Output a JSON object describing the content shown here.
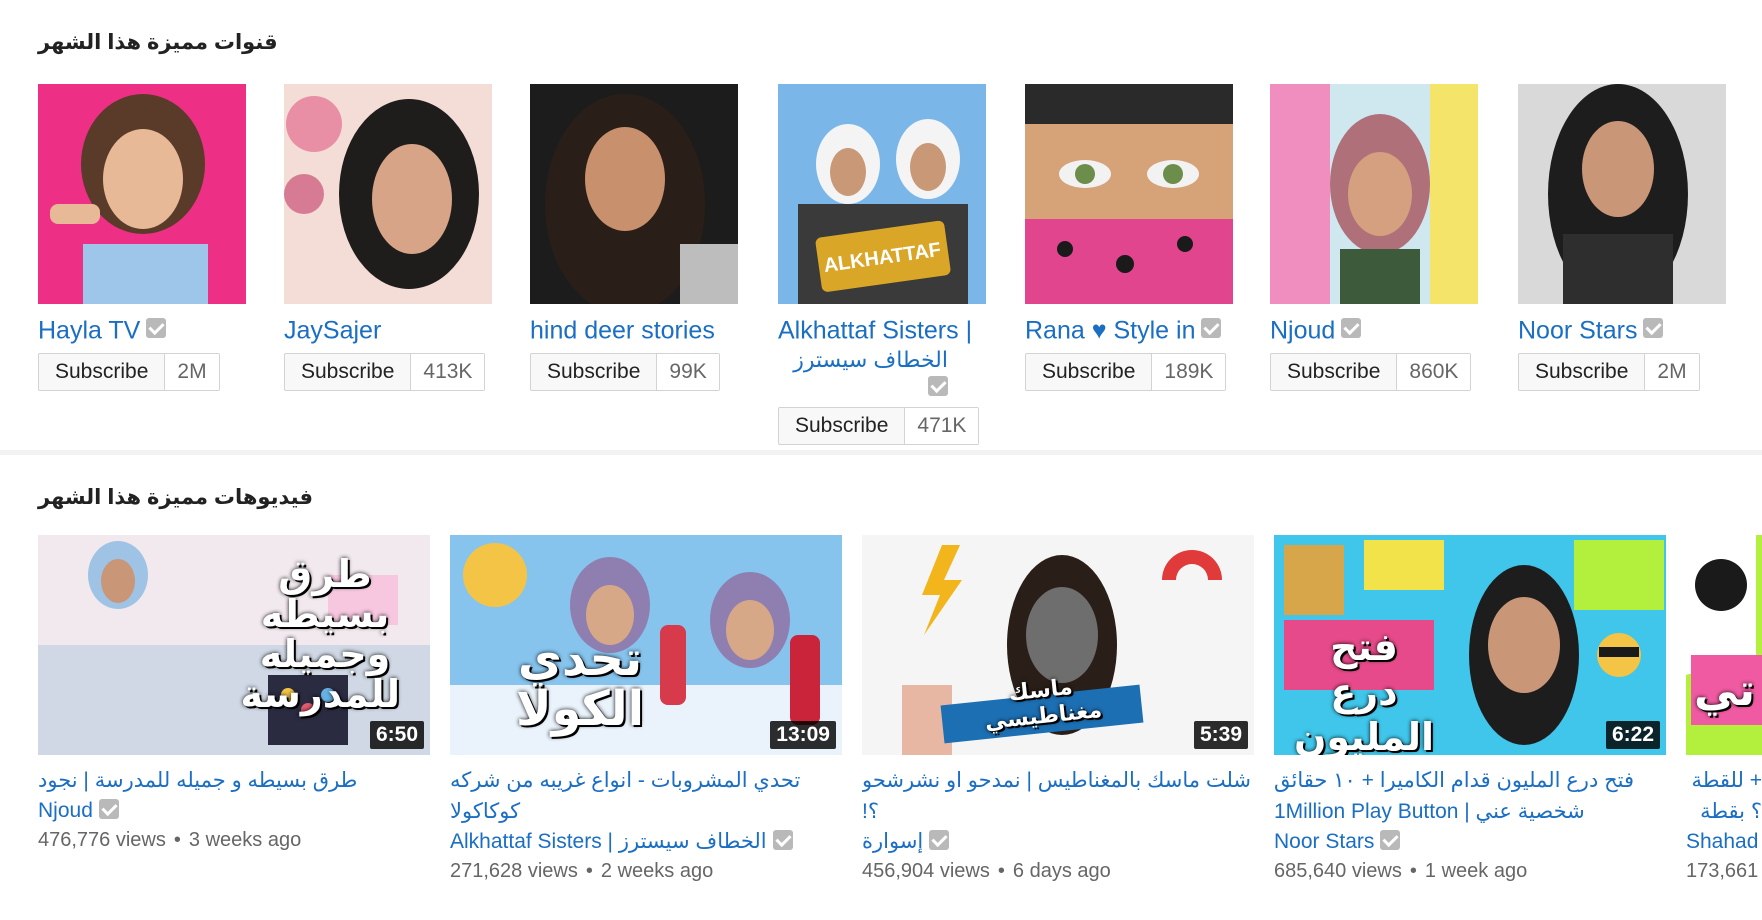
{
  "channels_shelf": {
    "title": "قنوات مميزة هذا الشهر",
    "channels": [
      {
        "name": "Hayla TV",
        "name2": "",
        "subscribe_label": "Subscribe",
        "count": "2M",
        "bg": "#ee2f86"
      },
      {
        "name": "JaySajer",
        "name2": "",
        "subscribe_label": "Subscribe",
        "count": "413K",
        "bg": "#f5e1de"
      },
      {
        "name": "hind deer stories",
        "name2": "",
        "subscribe_label": "Subscribe",
        "count": "99K",
        "bg": "#1f1f1f"
      },
      {
        "name": "Alkhattaf Sisters |",
        "name2": "الخطاف سيسترز",
        "subscribe_label": "Subscribe",
        "count": "471K",
        "bg": "#7ab6e8"
      },
      {
        "name": "Rana ♥ Style in",
        "name2": "",
        "subscribe_label": "Subscribe",
        "count": "189K",
        "bg": "#d6a277"
      },
      {
        "name": "Njoud",
        "name2": "",
        "subscribe_label": "Subscribe",
        "count": "860K",
        "bg": "#cfe8f0"
      },
      {
        "name": "Noor Stars",
        "name2": "",
        "subscribe_label": "Subscribe",
        "count": "2M",
        "bg": "#d9d9d9"
      }
    ]
  },
  "videos_shelf": {
    "title": "فيديوهات مميزة هذا الشهر",
    "videos": [
      {
        "title": "طرق بسيطه و جميله للمدرسة | نجود",
        "channel": "Njoud",
        "views": "476,776 views",
        "age": "3 weeks ago",
        "duration": "6:50",
        "overlay": "طرق بسيطه وجميله للمدرسة"
      },
      {
        "title": "تحدي المشروبات - انواع غريبه من شركه كوكاكولا",
        "channel": "Alkhattaf Sisters | الخطاف سيسترز",
        "views": "271,628 views",
        "age": "2 weeks ago",
        "duration": "13:09",
        "overlay": "تحدي الكولا"
      },
      {
        "title": "شلت ماسك بالمغناطيس | نمدحو او نشرشحو ؟!",
        "channel": "إسوارة",
        "views": "456,904 views",
        "age": "6 days ago",
        "duration": "5:39",
        "overlay": "ماسك مغناطيسي"
      },
      {
        "title": "فتح درع المليون قدام الكاميرا + ١٠ حقائق شخصية عني | 1Million Play Button",
        "channel": "Noor Stars",
        "views": "685,640 views",
        "age": "1 week ago",
        "duration": "6:22",
        "overlay": "فتح درع المليون"
      },
      {
        "title": "+ للقطة ؟ بقطة",
        "channel": "Shahad",
        "views": "173,661",
        "age": "",
        "duration": "",
        "overlay": "تي"
      }
    ]
  }
}
